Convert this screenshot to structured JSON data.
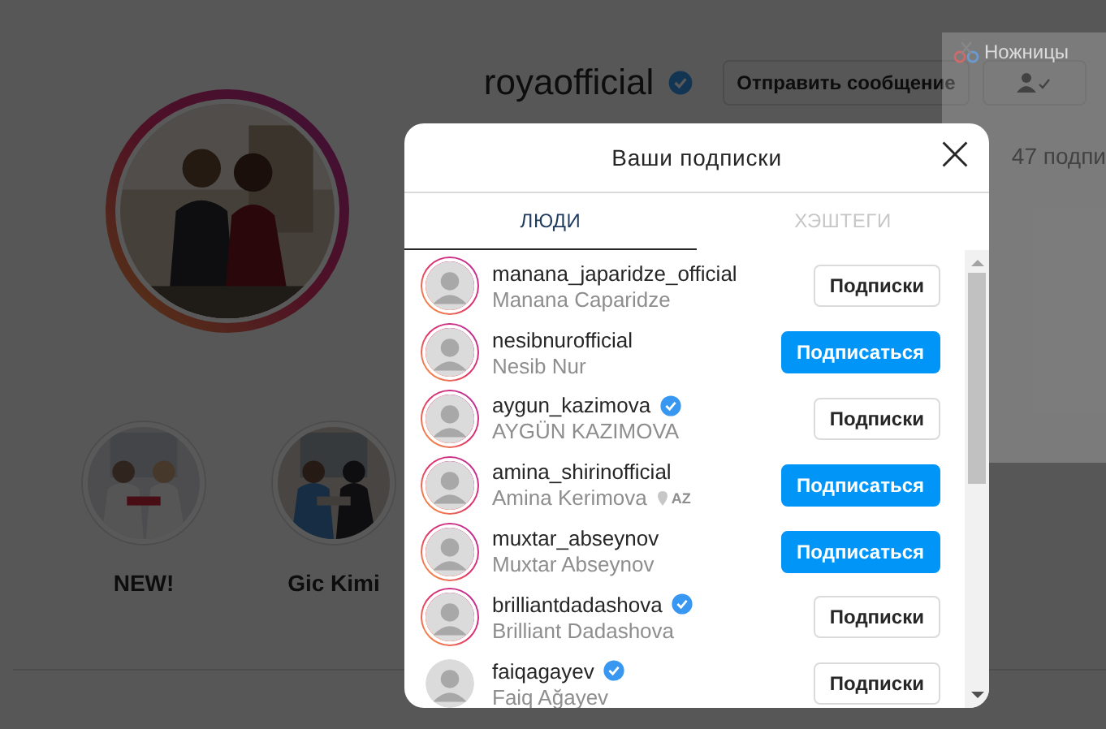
{
  "profile": {
    "username": "royaofficial",
    "verified": true,
    "message_button": "Отправить сообщение",
    "stats_text": "47 подпи"
  },
  "highlights": [
    {
      "title": "NEW!"
    },
    {
      "title": "Gic Kimi"
    }
  ],
  "snipping_tool": {
    "title": "Ножницы"
  },
  "modal": {
    "title": "Ваши подписки",
    "tabs": [
      {
        "label": "ЛЮДИ",
        "selected": true
      },
      {
        "label": "ХЭШТЕГИ",
        "selected": false
      }
    ],
    "accounts": [
      {
        "username": "manana_japaridze_official",
        "full_name": "Manana Caparidze",
        "verified": false,
        "has_story": true,
        "following": true,
        "button": "Подписки"
      },
      {
        "username": "nesibnurofficial",
        "full_name": "Nesib Nur",
        "verified": false,
        "has_story": true,
        "following": false,
        "button": "Подписаться"
      },
      {
        "username": "aygun_kazimova",
        "full_name": "AYGÜN KAZIMOVA",
        "verified": true,
        "has_story": true,
        "following": true,
        "button": "Подписки"
      },
      {
        "username": "amina_shirinofficial",
        "full_name": "Amina Kerimova",
        "location_tag": "AZ",
        "verified": false,
        "has_story": true,
        "following": false,
        "button": "Подписаться"
      },
      {
        "username": "muxtar_abseynov",
        "full_name": "Muxtar Abseynov",
        "verified": false,
        "has_story": true,
        "following": false,
        "button": "Подписаться"
      },
      {
        "username": "brilliantdadashova",
        "full_name": "Brilliant Dadashova",
        "verified": true,
        "has_story": true,
        "following": true,
        "button": "Подписки"
      },
      {
        "username": "faiqagayev",
        "full_name": "Faiq Ağayev",
        "verified": true,
        "has_story": false,
        "following": true,
        "button": "Подписки"
      }
    ]
  }
}
